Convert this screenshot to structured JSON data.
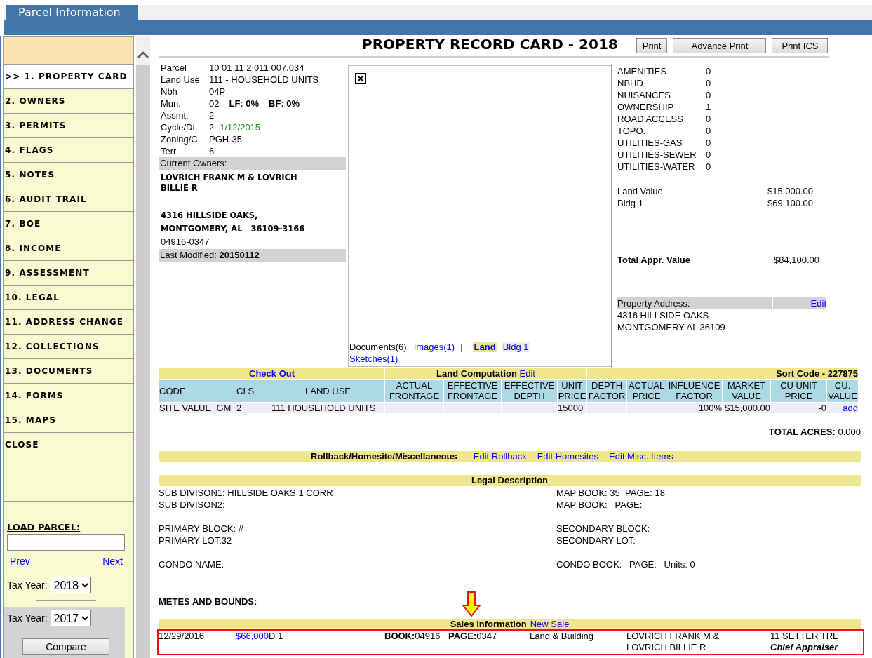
{
  "header": {
    "tab": "Parcel Information"
  },
  "sidebar": {
    "items": [
      {
        "label": ">> 1. PROPERTY CARD",
        "selected": true
      },
      {
        "label": "2. OWNERS",
        "selected": false
      },
      {
        "label": "3. PERMITS",
        "selected": false
      },
      {
        "label": "4. FLAGS",
        "selected": false
      },
      {
        "label": "5. NOTES",
        "selected": false
      },
      {
        "label": "6. AUDIT TRAIL",
        "selected": false
      },
      {
        "label": "7. BOE",
        "selected": false
      },
      {
        "label": "8. INCOME",
        "selected": false
      },
      {
        "label": "9. ASSESSMENT",
        "selected": false
      },
      {
        "label": "10. LEGAL",
        "selected": false
      },
      {
        "label": "11. ADDRESS CHANGE",
        "selected": false
      },
      {
        "label": "12. COLLECTIONS",
        "selected": false
      },
      {
        "label": "13. DOCUMENTS",
        "selected": false
      },
      {
        "label": "14. FORMS",
        "selected": false
      },
      {
        "label": "15. MAPS",
        "selected": false
      },
      {
        "label": "CLOSE",
        "selected": false
      }
    ],
    "load_parcel": {
      "label": "LOAD PARCEL:",
      "prev": "Prev",
      "next": "Next",
      "tax_year_label": "Tax Year:",
      "tax_year": "2018",
      "compare_tax_year_label": "Tax Year:",
      "compare_tax_year": "2017",
      "compare_button": "Compare"
    }
  },
  "card": {
    "title": "PROPERTY RECORD CARD - 2018",
    "buttons": [
      "Print",
      "Advance Print",
      "Print ICS"
    ],
    "parcel_fields": [
      {
        "label": "Parcel",
        "value": "10 01 11 2 011 007.034"
      },
      {
        "label": "Land Use",
        "value": "111 - HOUSEHOLD UNITS"
      },
      {
        "label": "Nbh",
        "value": "04P"
      },
      {
        "label": "Mun.",
        "value": "02",
        "extras": [
          "LF: 0%",
          "BF: 0%"
        ]
      },
      {
        "label": "Assmt.",
        "value": "2"
      },
      {
        "label": "Cycle/Dt.",
        "value": "2",
        "date": "1/12/2015"
      },
      {
        "label": "Zoning/C",
        "value": "PGH-35"
      },
      {
        "label": "Terr",
        "value": "6"
      }
    ],
    "owners": {
      "header": "Current Owners:",
      "names": "LOVRICH FRANK M & LOVRICH BILLIE R",
      "address": [
        "4316 HILLSIDE OAKS,",
        "MONTGOMERY, AL   36109-3166"
      ],
      "deed_link": "04916-0347",
      "last_modified_label": "Last Modified:",
      "last_modified": "20150112"
    },
    "media": {
      "documents": "Documents(6)",
      "images_link": "Images(1)",
      "separator": "|",
      "tabs": [
        {
          "label": "Land",
          "selected": true
        },
        {
          "label": "Bldg 1",
          "selected": false
        }
      ],
      "sketches_link": "Sketches(1)"
    },
    "attributes": [
      {
        "name": "AMENITIES",
        "value": "0"
      },
      {
        "name": "NBHD",
        "value": "0"
      },
      {
        "name": "NUISANCES",
        "value": "0"
      },
      {
        "name": "OWNERSHIP",
        "value": "1"
      },
      {
        "name": "ROAD ACCESS",
        "value": "0"
      },
      {
        "name": "TOPO.",
        "value": "0"
      },
      {
        "name": "UTILITIES-GAS",
        "value": "0"
      },
      {
        "name": "UTILITIES-SEWER",
        "value": "0"
      },
      {
        "name": "UTILITIES-WATER",
        "value": "0"
      }
    ],
    "values": [
      {
        "label": "Land Value",
        "amount": "$15,000.00"
      },
      {
        "label": "Bldg 1",
        "amount": "$69,100.00"
      }
    ],
    "total": {
      "label": "Total Appr. Value",
      "amount": "$84,100.00"
    },
    "property_address": {
      "label": "Property Address:",
      "edit": "Edit",
      "lines": [
        "4316 HILLSIDE OAKS",
        "MONTGOMERY AL 36109"
      ]
    }
  },
  "land": {
    "check_out": "Check Out",
    "title": "Land Computation",
    "edit": "Edit",
    "sort_code": "Sort Code - 227875",
    "columns": [
      "CODE",
      "CLS",
      "LAND USE",
      "ACTUAL FRONTAGE",
      "EFFECTIVE FRONTAGE",
      "EFFECTIVE DEPTH",
      "UNIT PRICE",
      "DEPTH FACTOR",
      "ACTUAL PRICE",
      "INFLUENCE FACTOR",
      "MARKET VALUE",
      "CU UNIT PRICE",
      "CU. VALUE"
    ],
    "rows": [
      [
        "SITE VALUE  GM",
        "2",
        "111 HOUSEHOLD UNITS",
        null,
        null,
        null,
        "15000",
        null,
        null,
        "100%",
        "$15,000.00",
        "-0",
        "add"
      ]
    ],
    "total_acres_label": "TOTAL ACRES:",
    "total_acres": "0.000"
  },
  "rollback": {
    "title": "Rollback/Homesite/Miscellaneous",
    "links": [
      "Edit Rollback",
      "Edit Homesites",
      "Edit Misc. Items"
    ]
  },
  "legal": {
    "title": "Legal Description",
    "left": [
      [
        "SUB DIVISON1: HILLSIDE OAKS 1 CORR",
        "SUB DIVISON2:"
      ],
      [
        "PRIMARY BLOCK: #",
        "PRIMARY LOT:32"
      ],
      [
        "CONDO NAME:"
      ]
    ],
    "right": [
      [
        "MAP BOOK: 35  PAGE: 18",
        "MAP BOOK:   PAGE:"
      ],
      [
        "SECONDARY BLOCK:",
        "SECONDARY LOT:"
      ],
      [
        "CONDO BOOK:   PAGE:   Units: 0"
      ]
    ]
  },
  "metes_and_bounds": "METES AND BOUNDS:",
  "sales": {
    "title": "Sales Information",
    "new_sale": "New Sale",
    "rows": [
      {
        "date": "12/29/2016",
        "price": "$66,000",
        "deed": "D 1",
        "book": "**BOOK:**04916",
        "page": "**PAGE:**0347",
        "type": "Land & Building",
        "grantor": "LOVRICH FRANK M & LOVRICH BILLIE R",
        "address": "11 SETTER TRL",
        "note": "Chief Appraiser",
        "highlighted": true
      }
    ]
  }
}
